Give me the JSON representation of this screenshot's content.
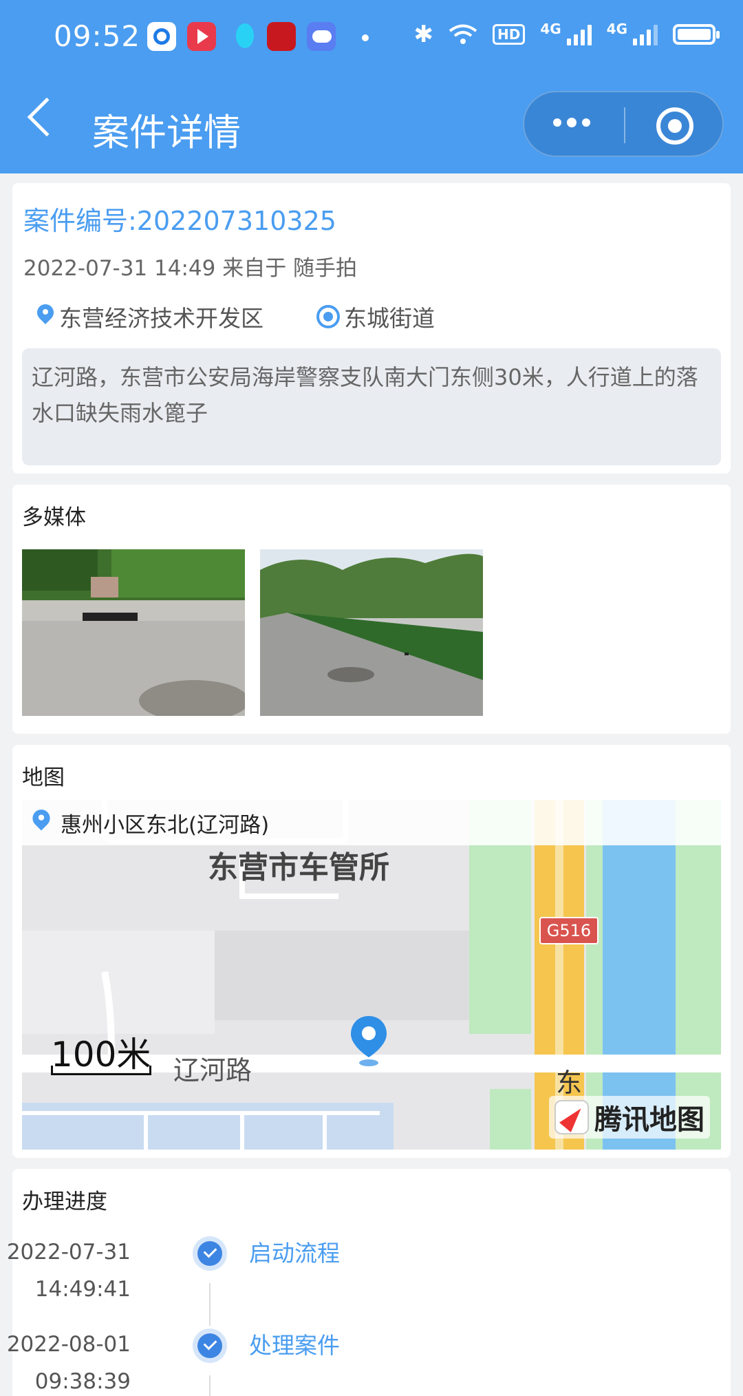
{
  "status_bar": {
    "time": "09:52",
    "hd_label": "HD",
    "network_1": "4G",
    "network_2": "4G"
  },
  "nav": {
    "title": "案件详情"
  },
  "case": {
    "number_label": "案件编号:202207310325",
    "meta": "2022-07-31 14:49 来自于 随手拍",
    "district": "东营经济技术开发区",
    "street": "东城街道",
    "description": "辽河路，东营市公安局海岸警察支队南大门东侧30米，人行道上的落水口缺失雨水篦子"
  },
  "media": {
    "title": "多媒体",
    "photo_count": 2
  },
  "map": {
    "title": "地图",
    "address": "惠州小区东北(辽河路)",
    "poi": "东营市车管所",
    "road": "辽河路",
    "road_badge": "G516",
    "scale": "100米",
    "side_char": "东",
    "brand": "腾讯地图"
  },
  "progress": {
    "title": "办理进度",
    "steps": [
      {
        "date": "2022-07-31",
        "time": "14:49:41",
        "label": "启动流程"
      },
      {
        "date": "2022-08-01",
        "time": "09:38:39",
        "label": "处理案件"
      }
    ]
  },
  "colors": {
    "primary": "#4a9df0",
    "status_accent": "#3d85e3"
  }
}
